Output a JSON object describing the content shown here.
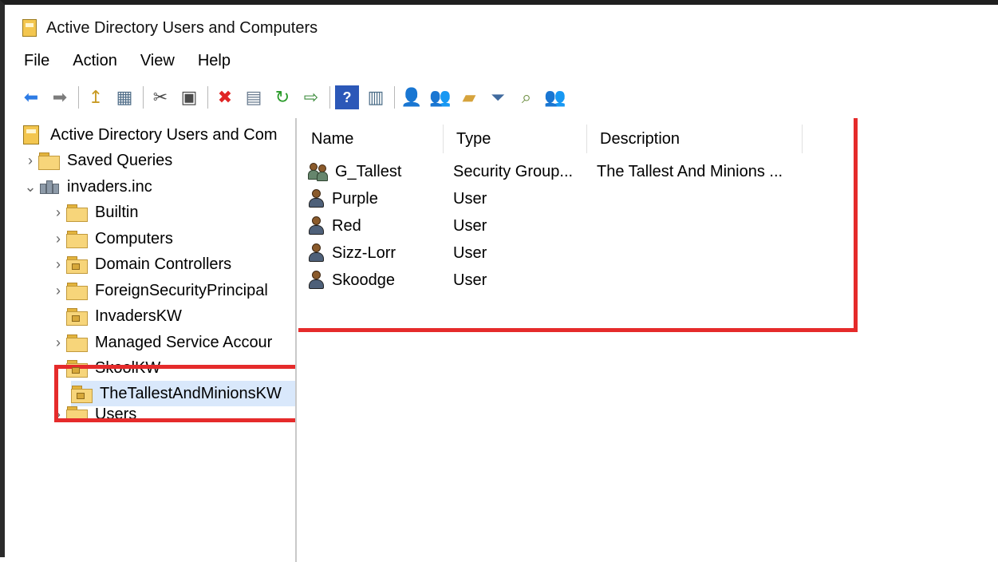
{
  "window": {
    "title": "Active Directory Users and Computers"
  },
  "menu": [
    {
      "label": "File"
    },
    {
      "label": "Action"
    },
    {
      "label": "View"
    },
    {
      "label": "Help"
    }
  ],
  "toolbar": [
    {
      "icon": "back-arrow-icon",
      "glyph": "⬅",
      "color": "#2d7be5"
    },
    {
      "icon": "forward-arrow-icon",
      "glyph": "➡",
      "color": "#7c7c7c"
    },
    {
      "icon": "up-folder-icon",
      "glyph": "↥",
      "color": "#c89a22"
    },
    {
      "icon": "show-hide-console-tree-icon",
      "glyph": "▦",
      "color": "#4f6d88"
    },
    {
      "icon": "cut-icon",
      "glyph": "✂",
      "color": "#4b4b4b"
    },
    {
      "icon": "copy-icon",
      "glyph": "▣",
      "color": "#4b4b4b"
    },
    {
      "icon": "delete-icon",
      "glyph": "✖",
      "color": "#e02424"
    },
    {
      "icon": "properties-icon",
      "glyph": "▤",
      "color": "#697b8f"
    },
    {
      "icon": "refresh-icon",
      "glyph": "↻",
      "color": "#2a9b2a"
    },
    {
      "icon": "export-list-icon",
      "glyph": "⇨",
      "color": "#3a8a3a"
    },
    {
      "icon": "help-icon",
      "glyph": "?",
      "color": "#ffffff"
    },
    {
      "icon": "action-pane-icon",
      "glyph": "▥",
      "color": "#4b6d88"
    },
    {
      "icon": "new-user-icon",
      "glyph": "👤",
      "color": "#b77a2c"
    },
    {
      "icon": "new-group-icon",
      "glyph": "👥",
      "color": "#8f8f2e"
    },
    {
      "icon": "new-ou-icon",
      "glyph": "▰",
      "color": "#d6a33c"
    },
    {
      "icon": "filter-icon",
      "glyph": "⏷",
      "color": "#406a9e"
    },
    {
      "icon": "find-icon",
      "glyph": "⌕",
      "color": "#6e8f42"
    },
    {
      "icon": "delegate-control-icon",
      "glyph": "👥",
      "color": "#7a7a7a"
    }
  ],
  "tree": {
    "root": "Active Directory Users and Com",
    "items": [
      {
        "label": "Saved Queries"
      },
      {
        "label": "invaders.inc"
      },
      {
        "label": "Builtin"
      },
      {
        "label": "Computers"
      },
      {
        "label": "Domain Controllers"
      },
      {
        "label": "ForeignSecurityPrincipal"
      },
      {
        "label": "InvadersKW"
      },
      {
        "label": "Managed Service Accour"
      },
      {
        "label": "SkoolKW"
      },
      {
        "label": "TheTallestAndMinionsKW"
      },
      {
        "label": "Users"
      }
    ]
  },
  "list": {
    "headers": {
      "name": "Name",
      "type": "Type",
      "description": "Description"
    },
    "rows": [
      {
        "name": "G_Tallest",
        "type": "Security Group...",
        "description": "The Tallest And Minions ..."
      },
      {
        "name": "Purple",
        "type": "User",
        "description": ""
      },
      {
        "name": "Red",
        "type": "User",
        "description": ""
      },
      {
        "name": "Sizz-Lorr",
        "type": "User",
        "description": ""
      },
      {
        "name": "Skoodge",
        "type": "User",
        "description": ""
      }
    ]
  },
  "colors": {
    "highlight": "#e52b2b",
    "selected": "#d9e8fb"
  }
}
